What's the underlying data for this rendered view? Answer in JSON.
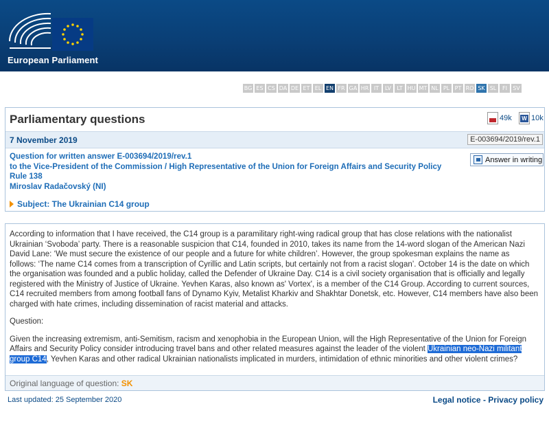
{
  "header": {
    "brand": "European Parliament",
    "logo_icon": "european-parliament-logo"
  },
  "languages": {
    "items": [
      "BG",
      "ES",
      "CS",
      "DA",
      "DE",
      "ET",
      "EL",
      "EN",
      "FR",
      "GA",
      "HR",
      "IT",
      "LV",
      "LT",
      "HU",
      "MT",
      "NL",
      "PL",
      "PT",
      "RO",
      "SK",
      "SL",
      "FI",
      "SV"
    ],
    "active": "EN",
    "highlighted": "SK"
  },
  "question": {
    "section_title": "Parliamentary questions",
    "pdf_size": "49k",
    "doc_size": "10k",
    "date": "7 November 2019",
    "reference": "E-003694/2019/rev.1",
    "line1": "Question for written answer E-003694/2019/rev.1",
    "line2": "to the Vice-President of the Commission / High Representative of the Union for Foreign Affairs and Security Policy",
    "line3": "Rule 138",
    "line4": "Miroslav Radačovský (NI)",
    "answer_button": "Answer in writing",
    "subject": "Subject: The Ukrainian C14 group"
  },
  "body": {
    "paragraph1": "According to information that I have received, the C14 group is a paramilitary right-wing radical group that has close relations with the nationalist Ukrainian ‘Svoboda’ party. There is a reasonable suspicion that C14, founded in 2010, takes its name from the 14-word slogan of the American Nazi David Lane: ‘We must secure the existence of our people and a future for white children’. However, the group spokesman explains the name as follows: ‘The name C14 comes from a transcription of Cyrillic and Latin scripts, but certainly not from a racist slogan’. October 14 is the date on which the organisation was founded and a public holiday, called the Defender of Ukraine Day. C14 is a civil society organisation that is officially and legally registered with the Ministry of Justice of Ukraine. Yevhen Karas, also known as' Vortex', is a member of the C14 Group. According to current sources, C14 recruited members from among football fans of Dynamo Kyiv, Metalist Kharkiv and Shakhtar Donetsk, etc. However, C14 members have also been charged with hate crimes, including dissemination of racist material and attacks.",
    "question_label": "Question:",
    "paragraph2_before": "Given the increasing extremism, anti-Semitism, racism and xenophobia in the European Union, will the High Representative of the Union for Foreign Affairs and Security Policy consider introducing travel bans and other related measures against the leader of the violent ",
    "paragraph2_highlight": "Ukrainian neo-Nazi militant group C14",
    "paragraph2_after": ", Yevhen Karas and other radical Ukrainian nationalists implicated in murders, intimidation of ethnic minorities and other violent crimes?",
    "original_language_label": "Original language of question: ",
    "original_language": "SK"
  },
  "footer": {
    "last_updated": "Last updated: 25 September 2020",
    "legal_notice": "Legal notice",
    "separator": " - ",
    "privacy_policy": "Privacy policy"
  },
  "colors": {
    "header_blue": "#0b4a86",
    "link_blue": "#1e6db7",
    "accent_orange": "#f29100",
    "highlight": "#1e6bd6"
  }
}
